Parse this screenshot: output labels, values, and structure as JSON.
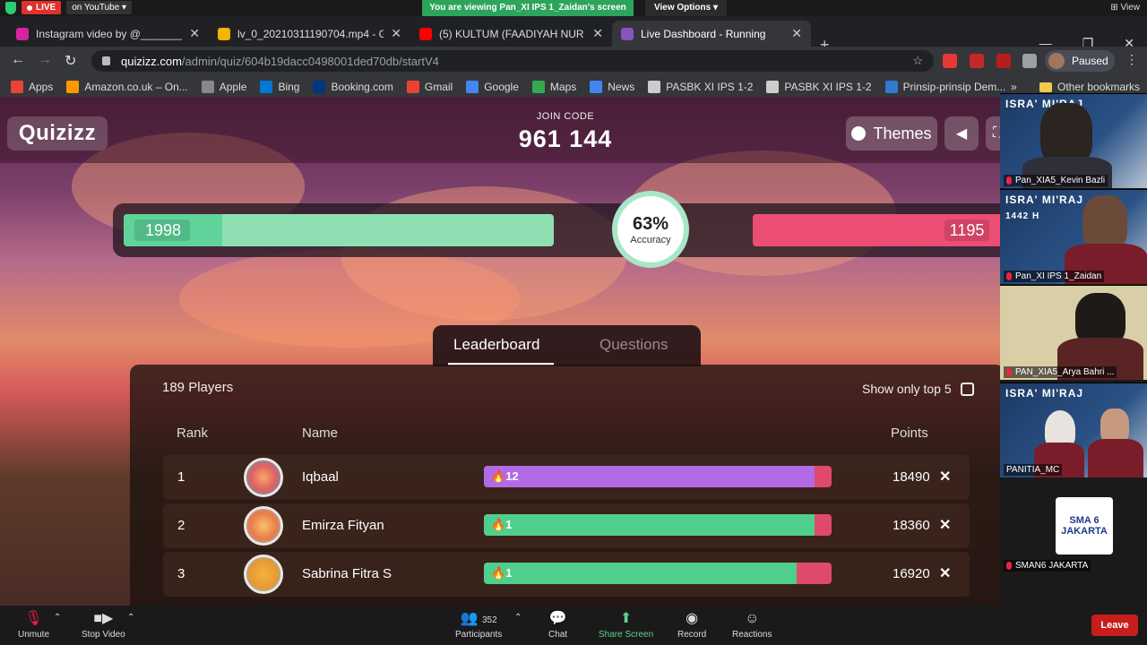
{
  "zoom_top": {
    "live_label": "LIVE",
    "on_youtube": "on YouTube",
    "viewing": "You are viewing Pan_XI IPS 1_Zaidan's screen",
    "view_options": "View Options",
    "view": "View"
  },
  "tabs": [
    {
      "title": "Instagram video by @___________",
      "color": "#d6249f"
    },
    {
      "title": "lv_0_20210311190704.mp4 - Goo",
      "color": "#f4b400"
    },
    {
      "title": "(5) KULTUM (FAADIYAH NUR AAR",
      "color": "#ff0000"
    },
    {
      "title": "Live Dashboard - Running",
      "color": "#8854c0"
    }
  ],
  "address": {
    "host": "quizizz.com",
    "path": "/admin/quiz/604b19dacc0498001ded70db/startV4",
    "profile_status": "Paused"
  },
  "bookmarks": [
    {
      "label": "Apps",
      "color": "#ea4335"
    },
    {
      "label": "Amazon.co.uk – On...",
      "color": "#ff9900"
    },
    {
      "label": "Apple",
      "color": "#888888"
    },
    {
      "label": "Bing",
      "color": "#0078d7"
    },
    {
      "label": "Booking.com",
      "color": "#003580"
    },
    {
      "label": "Gmail",
      "color": "#ea4335"
    },
    {
      "label": "Google",
      "color": "#4285f4"
    },
    {
      "label": "Maps",
      "color": "#34a853"
    },
    {
      "label": "News",
      "color": "#4285f4"
    },
    {
      "label": "PASBK XI IPS 1-2",
      "color": "#cccccc"
    },
    {
      "label": "PASBK XI IPS 1-2",
      "color": "#cccccc"
    },
    {
      "label": "Prinsip-prinsip Dem...",
      "color": "#2e7bcf"
    }
  ],
  "other_bookmarks": "Other bookmarks",
  "quiz": {
    "logo": "Quizizz",
    "join_label": "JOIN CODE",
    "join_code": "961 144",
    "themes": "Themes",
    "correct_count": "1998",
    "incorrect_count": "1195",
    "accuracy_pct": "63%",
    "accuracy_label": "Accuracy",
    "accuracy_fraction": 0.63,
    "tab_leaderboard": "Leaderboard",
    "tab_questions": "Questions",
    "players": "189 Players",
    "show_top5": "Show only top 5",
    "col_rank": "Rank",
    "col_name": "Name",
    "col_points": "Points",
    "rows": [
      {
        "rank": "1",
        "name": "Iqbaal",
        "streak": "12",
        "points": "18490",
        "correct_fraction": 0.95,
        "color": "#b36ae6"
      },
      {
        "rank": "2",
        "name": "Emirza Fityan",
        "streak": "1",
        "points": "18360",
        "correct_fraction": 0.95,
        "color": "#4fcf8c"
      },
      {
        "rank": "3",
        "name": "Sabrina Fitra S",
        "streak": "1",
        "points": "16920",
        "correct_fraction": 0.9,
        "color": "#4fcf8c"
      }
    ]
  },
  "participants_videos": [
    {
      "name": "Pan_XIA5_Kevin Bazli"
    },
    {
      "name": "Pan_XI IPS 1_Zaidan"
    },
    {
      "name": "PAN_XIA5_Arya Bahri ..."
    },
    {
      "name": "PANITIA_MC"
    }
  ],
  "sman_label": "SMAN6 JAKARTA",
  "poster_title": "ISRA' MI'RAJ",
  "poster_year": "1442 H",
  "logo_text": "SMA 6 JAKARTA",
  "controls": {
    "unmute": "Unmute",
    "stop_video": "Stop Video",
    "participants": "Participants",
    "participant_count": "352",
    "chat": "Chat",
    "share": "Share Screen",
    "record": "Record",
    "reactions": "Reactions",
    "leave": "Leave"
  }
}
